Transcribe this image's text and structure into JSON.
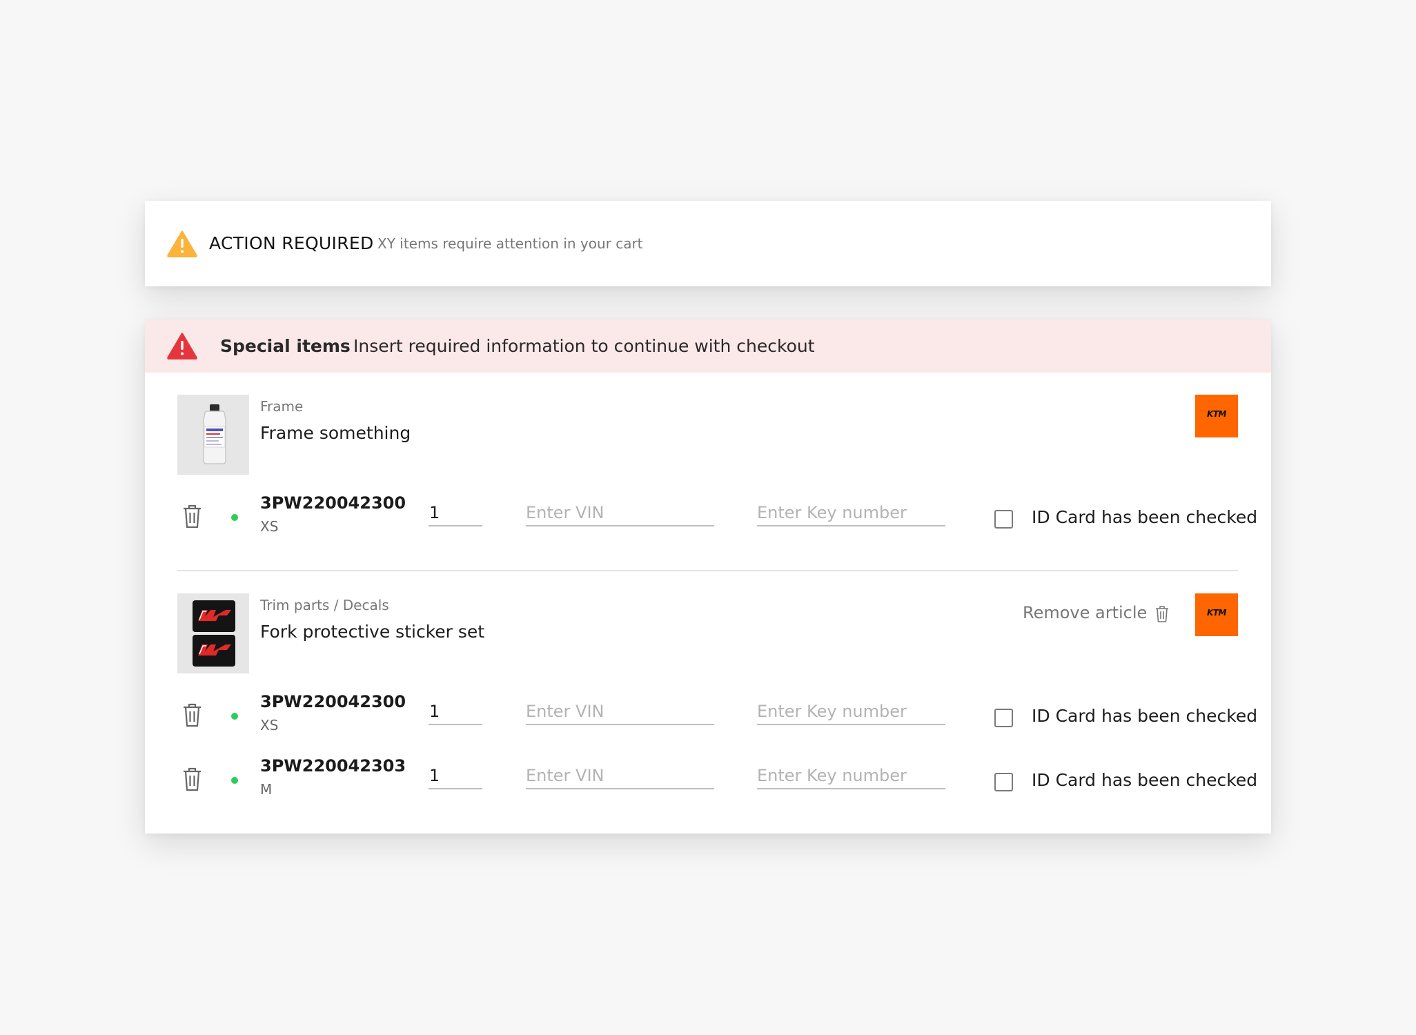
{
  "alert": {
    "title": "ACTION REQUIRED",
    "subtitle": "XY items require attention in your cart",
    "icon": "warning-triangle-icon",
    "color": "#fbb33a"
  },
  "special": {
    "title": "Special items",
    "message": "Insert required information to continue with checkout",
    "icon": "error-triangle-icon",
    "banner_bg": "#fbe8e9",
    "icon_color": "#e5363d"
  },
  "articles": [
    {
      "category": "Frame",
      "name": "Frame something",
      "brand": "KTM",
      "brand_color": "#ff6600",
      "thumbnail": "bottle",
      "variants": [
        {
          "sku": "3PW220042300",
          "size": "XS",
          "qty": "1",
          "vin_placeholder": "Enter VIN",
          "key_placeholder": "Enter Key number",
          "id_check_label": "ID Card has been checked",
          "checked": false
        }
      ]
    },
    {
      "category": "Trim parts / Decals",
      "name": "Fork protective sticker set",
      "brand": "KTM",
      "brand_color": "#ff6600",
      "thumbnail": "sticker-set",
      "remove_label": "Remove article",
      "variants": [
        {
          "sku": "3PW220042300",
          "size": "XS",
          "qty": "1",
          "vin_placeholder": "Enter VIN",
          "key_placeholder": "Enter Key number",
          "id_check_label": "ID Card has been checked",
          "checked": false
        },
        {
          "sku": "3PW220042303",
          "size": "M",
          "qty": "1",
          "vin_placeholder": "Enter VIN",
          "key_placeholder": "Enter Key number",
          "id_check_label": "ID Card has been checked",
          "checked": false
        }
      ]
    }
  ],
  "status_color": "#2ecc5a"
}
